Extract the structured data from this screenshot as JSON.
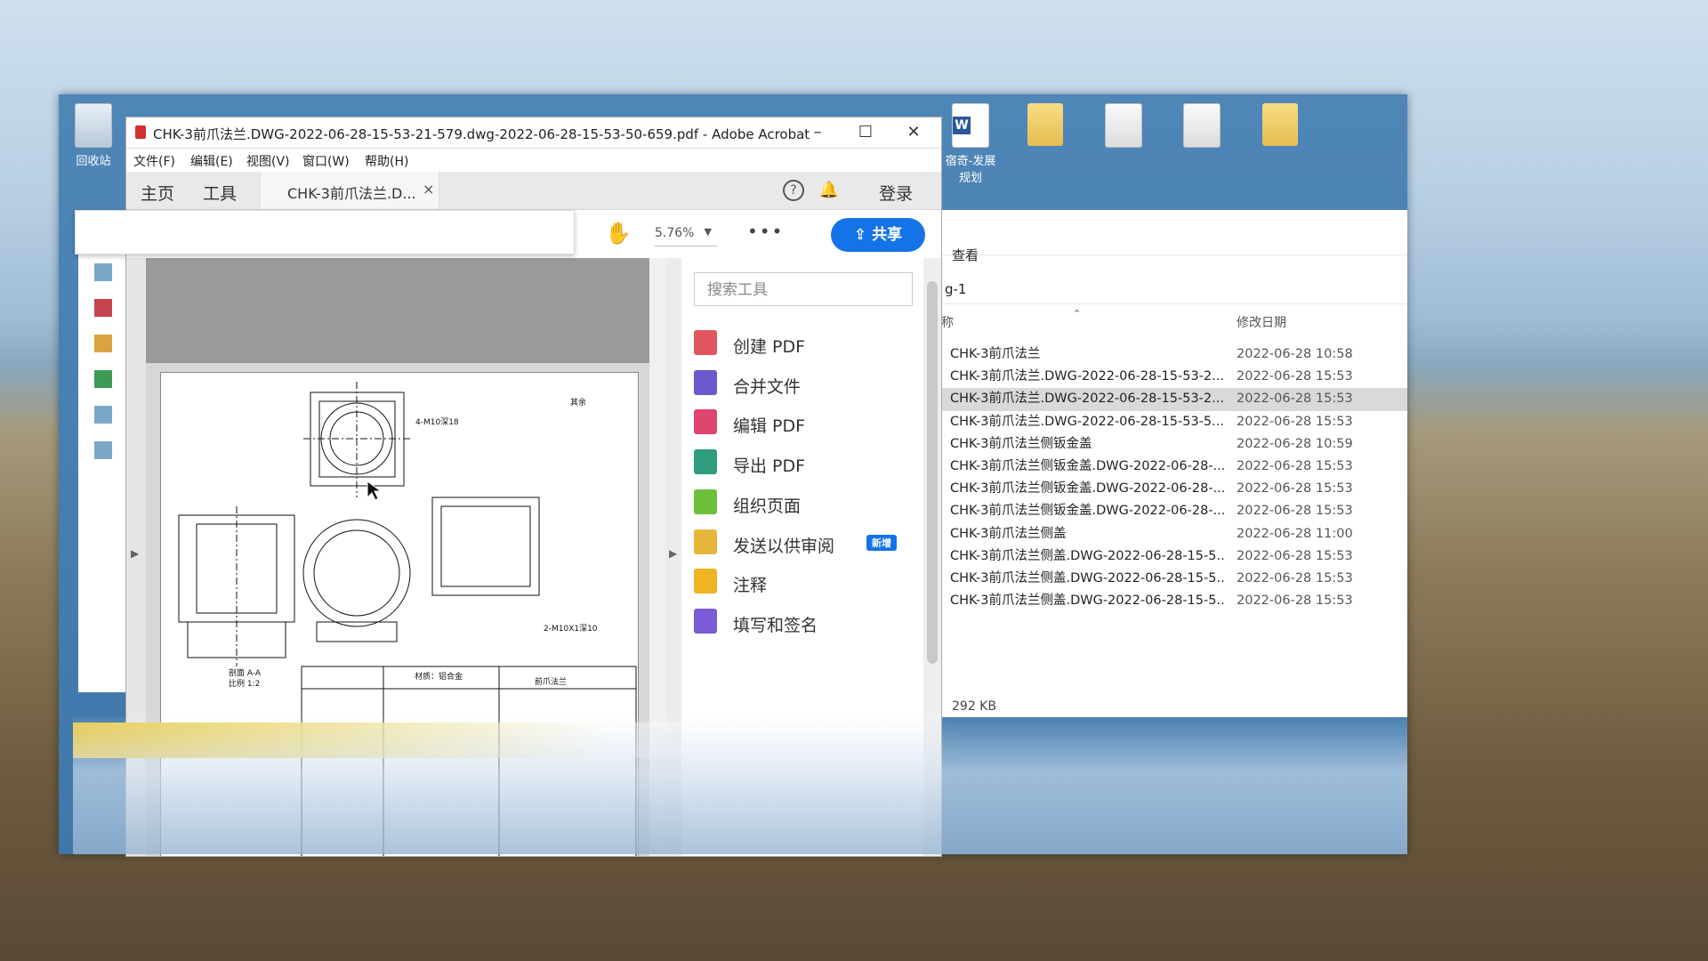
{
  "desktop": {
    "recycle_bin": "回收站",
    "word_icon_label_1": "宿奇-发展",
    "word_icon_label_2": "规划"
  },
  "acrobat": {
    "title": "CHK-3前爪法兰.DWG-2022-06-28-15-53-21-579.dwg-2022-06-28-15-53-50-659.pdf - Adobe Acrobat ...",
    "menu": [
      "文件(F)",
      "编辑(E)",
      "视图(V)",
      "窗口(W)",
      "帮助(H)"
    ],
    "tabs": {
      "home": "主页",
      "tools": "工具",
      "doc_tab": "CHK-3前爪法兰.D...",
      "close": "×"
    },
    "login": "登录",
    "zoom": "5.76%",
    "share": "共享",
    "search_placeholder": "搜索工具",
    "tools": [
      {
        "label": "创建 PDF",
        "icon": "create-pdf-icon",
        "color": "#e0555f"
      },
      {
        "label": "合并文件",
        "icon": "combine-files-icon",
        "color": "#6a5acd"
      },
      {
        "label": "编辑 PDF",
        "icon": "edit-pdf-icon",
        "color": "#e0456f"
      },
      {
        "label": "导出 PDF",
        "icon": "export-pdf-icon",
        "color": "#2e9e7e"
      },
      {
        "label": "组织页面",
        "icon": "organize-pages-icon",
        "color": "#6bbf3a"
      },
      {
        "label": "发送以供审阅",
        "icon": "send-review-icon",
        "color": "#e6b73a"
      },
      {
        "label": "注释",
        "icon": "comment-icon",
        "color": "#f0b323"
      },
      {
        "label": "填写和签名",
        "icon": "fill-sign-icon",
        "color": "#7a5cd6"
      }
    ],
    "new_badge": "新增",
    "drawing": {
      "labels": [
        "前爪法兰",
        "剖面 A-A",
        "比例 1:2",
        "材质：铝合金",
        "4-M10深18",
        "2-M10X1深10",
        "其余"
      ]
    }
  },
  "explorer": {
    "view_tab": "查看",
    "path": "g-1",
    "col_name": "称",
    "col_date": "修改日期",
    "files": [
      {
        "name": "CHK-3前爪法兰",
        "date": "2022-06-28 10:58"
      },
      {
        "name": "CHK-3前爪法兰.DWG-2022-06-28-15-53-2...",
        "date": "2022-06-28 15:53"
      },
      {
        "name": "CHK-3前爪法兰.DWG-2022-06-28-15-53-2...",
        "date": "2022-06-28 15:53"
      },
      {
        "name": "CHK-3前爪法兰.DWG-2022-06-28-15-53-5...",
        "date": "2022-06-28 15:53"
      },
      {
        "name": "CHK-3前爪法兰侧钣金盖",
        "date": "2022-06-28 10:59"
      },
      {
        "name": "CHK-3前爪法兰侧钣金盖.DWG-2022-06-28-...",
        "date": "2022-06-28 15:53"
      },
      {
        "name": "CHK-3前爪法兰侧钣金盖.DWG-2022-06-28-...",
        "date": "2022-06-28 15:53"
      },
      {
        "name": "CHK-3前爪法兰侧钣金盖.DWG-2022-06-28-...",
        "date": "2022-06-28 15:53"
      },
      {
        "name": "CHK-3前爪法兰侧盖",
        "date": "2022-06-28 11:00"
      },
      {
        "name": "CHK-3前爪法兰侧盖.DWG-2022-06-28-15-5...",
        "date": "2022-06-28 15:53"
      },
      {
        "name": "CHK-3前爪法兰侧盖.DWG-2022-06-28-15-5...",
        "date": "2022-06-28 15:53"
      },
      {
        "name": "CHK-3前爪法兰侧盖.DWG-2022-06-28-15-5...",
        "date": "2022-06-28 15:53"
      }
    ],
    "selected_index": 2,
    "size": "292 KB"
  }
}
